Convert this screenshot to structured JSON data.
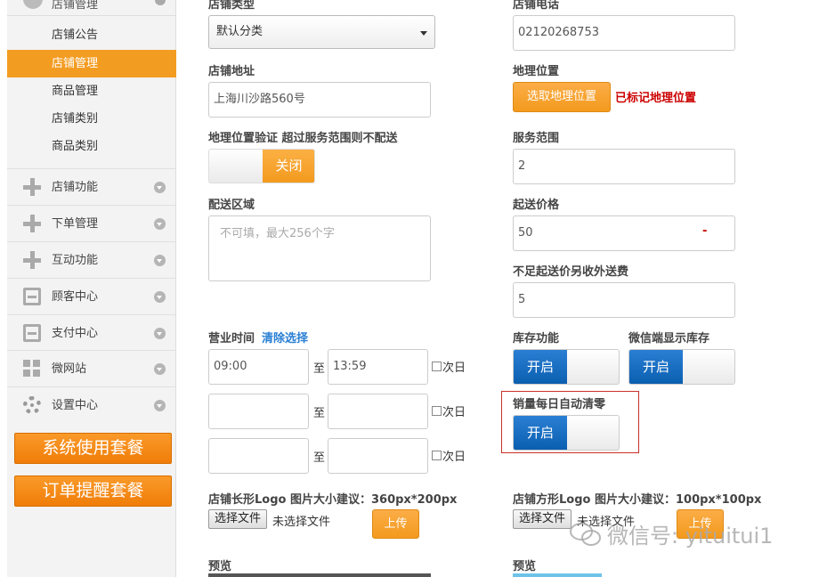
{
  "sidebar": {
    "top_group_label": "店铺管理",
    "sub_items": [
      "店铺公告",
      "店铺管理",
      "商品管理",
      "店铺类别",
      "商品类别"
    ],
    "active_sub_index": 1,
    "groups": [
      {
        "label": "店铺功能",
        "icon": "plus-icon"
      },
      {
        "label": "下单管理",
        "icon": "plus-icon"
      },
      {
        "label": "互动功能",
        "icon": "plus-icon"
      },
      {
        "label": "顾客中心",
        "icon": "inbox-icon"
      },
      {
        "label": "支付中心",
        "icon": "inbox-icon"
      },
      {
        "label": "微网站",
        "icon": "tiles-icon"
      },
      {
        "label": "设置中心",
        "icon": "gear-icon"
      }
    ],
    "package_buttons": [
      "系统使用套餐",
      "订单提醒套餐"
    ]
  },
  "form": {
    "store_type_label": "店铺类型",
    "store_type_value": "默认分类",
    "store_phone_label": "店铺电话",
    "store_phone_value": "02120268753",
    "address_label": "店铺地址",
    "address_value": "上海川沙路560号",
    "location_label": "地理位置",
    "location_button": "选取地理位置",
    "location_status": "已标记地理位置",
    "geo_verify_label": "地理位置验证 超过服务范围则不配送",
    "geo_verify_state": "关闭",
    "service_range_label": "服务范围",
    "service_range_value": "2",
    "delivery_area_label": "配送区域",
    "delivery_area_placeholder": "不可填，最大256个字",
    "min_price_label": "起送价格",
    "min_price_value": "50",
    "min_price_mark": "-",
    "extra_fee_label": "不足起送价另收外送费",
    "extra_fee_value": "5",
    "hours_label": "营业时间",
    "clear_link": "清除选择",
    "hours_sep": "至",
    "next_day": "次日",
    "hours_rows": [
      {
        "start": "09:00",
        "end": "13:59"
      },
      {
        "start": "",
        "end": ""
      },
      {
        "start": "",
        "end": ""
      }
    ],
    "stock_label": "库存功能",
    "stock_state": "开启",
    "wechat_stock_label": "微信端显示库存",
    "wechat_stock_state": "开启",
    "daily_reset_label": "销量每日自动清零",
    "daily_reset_state": "开启",
    "long_logo_label": "店铺长形Logo 图片大小建议：360px*200px",
    "square_logo_label": "店铺方形Logo 图片大小建议：100px*100px",
    "choose_file": "选择文件",
    "no_file": "未选择文件",
    "upload": "上传",
    "preview": "预览"
  },
  "watermark": "微信号: yituitui1",
  "colors": {
    "accent_orange": "#f39c22",
    "toggle_blue": "#0b5fb0",
    "alert_red": "#cc0000",
    "link_blue": "#2a7fd4"
  }
}
